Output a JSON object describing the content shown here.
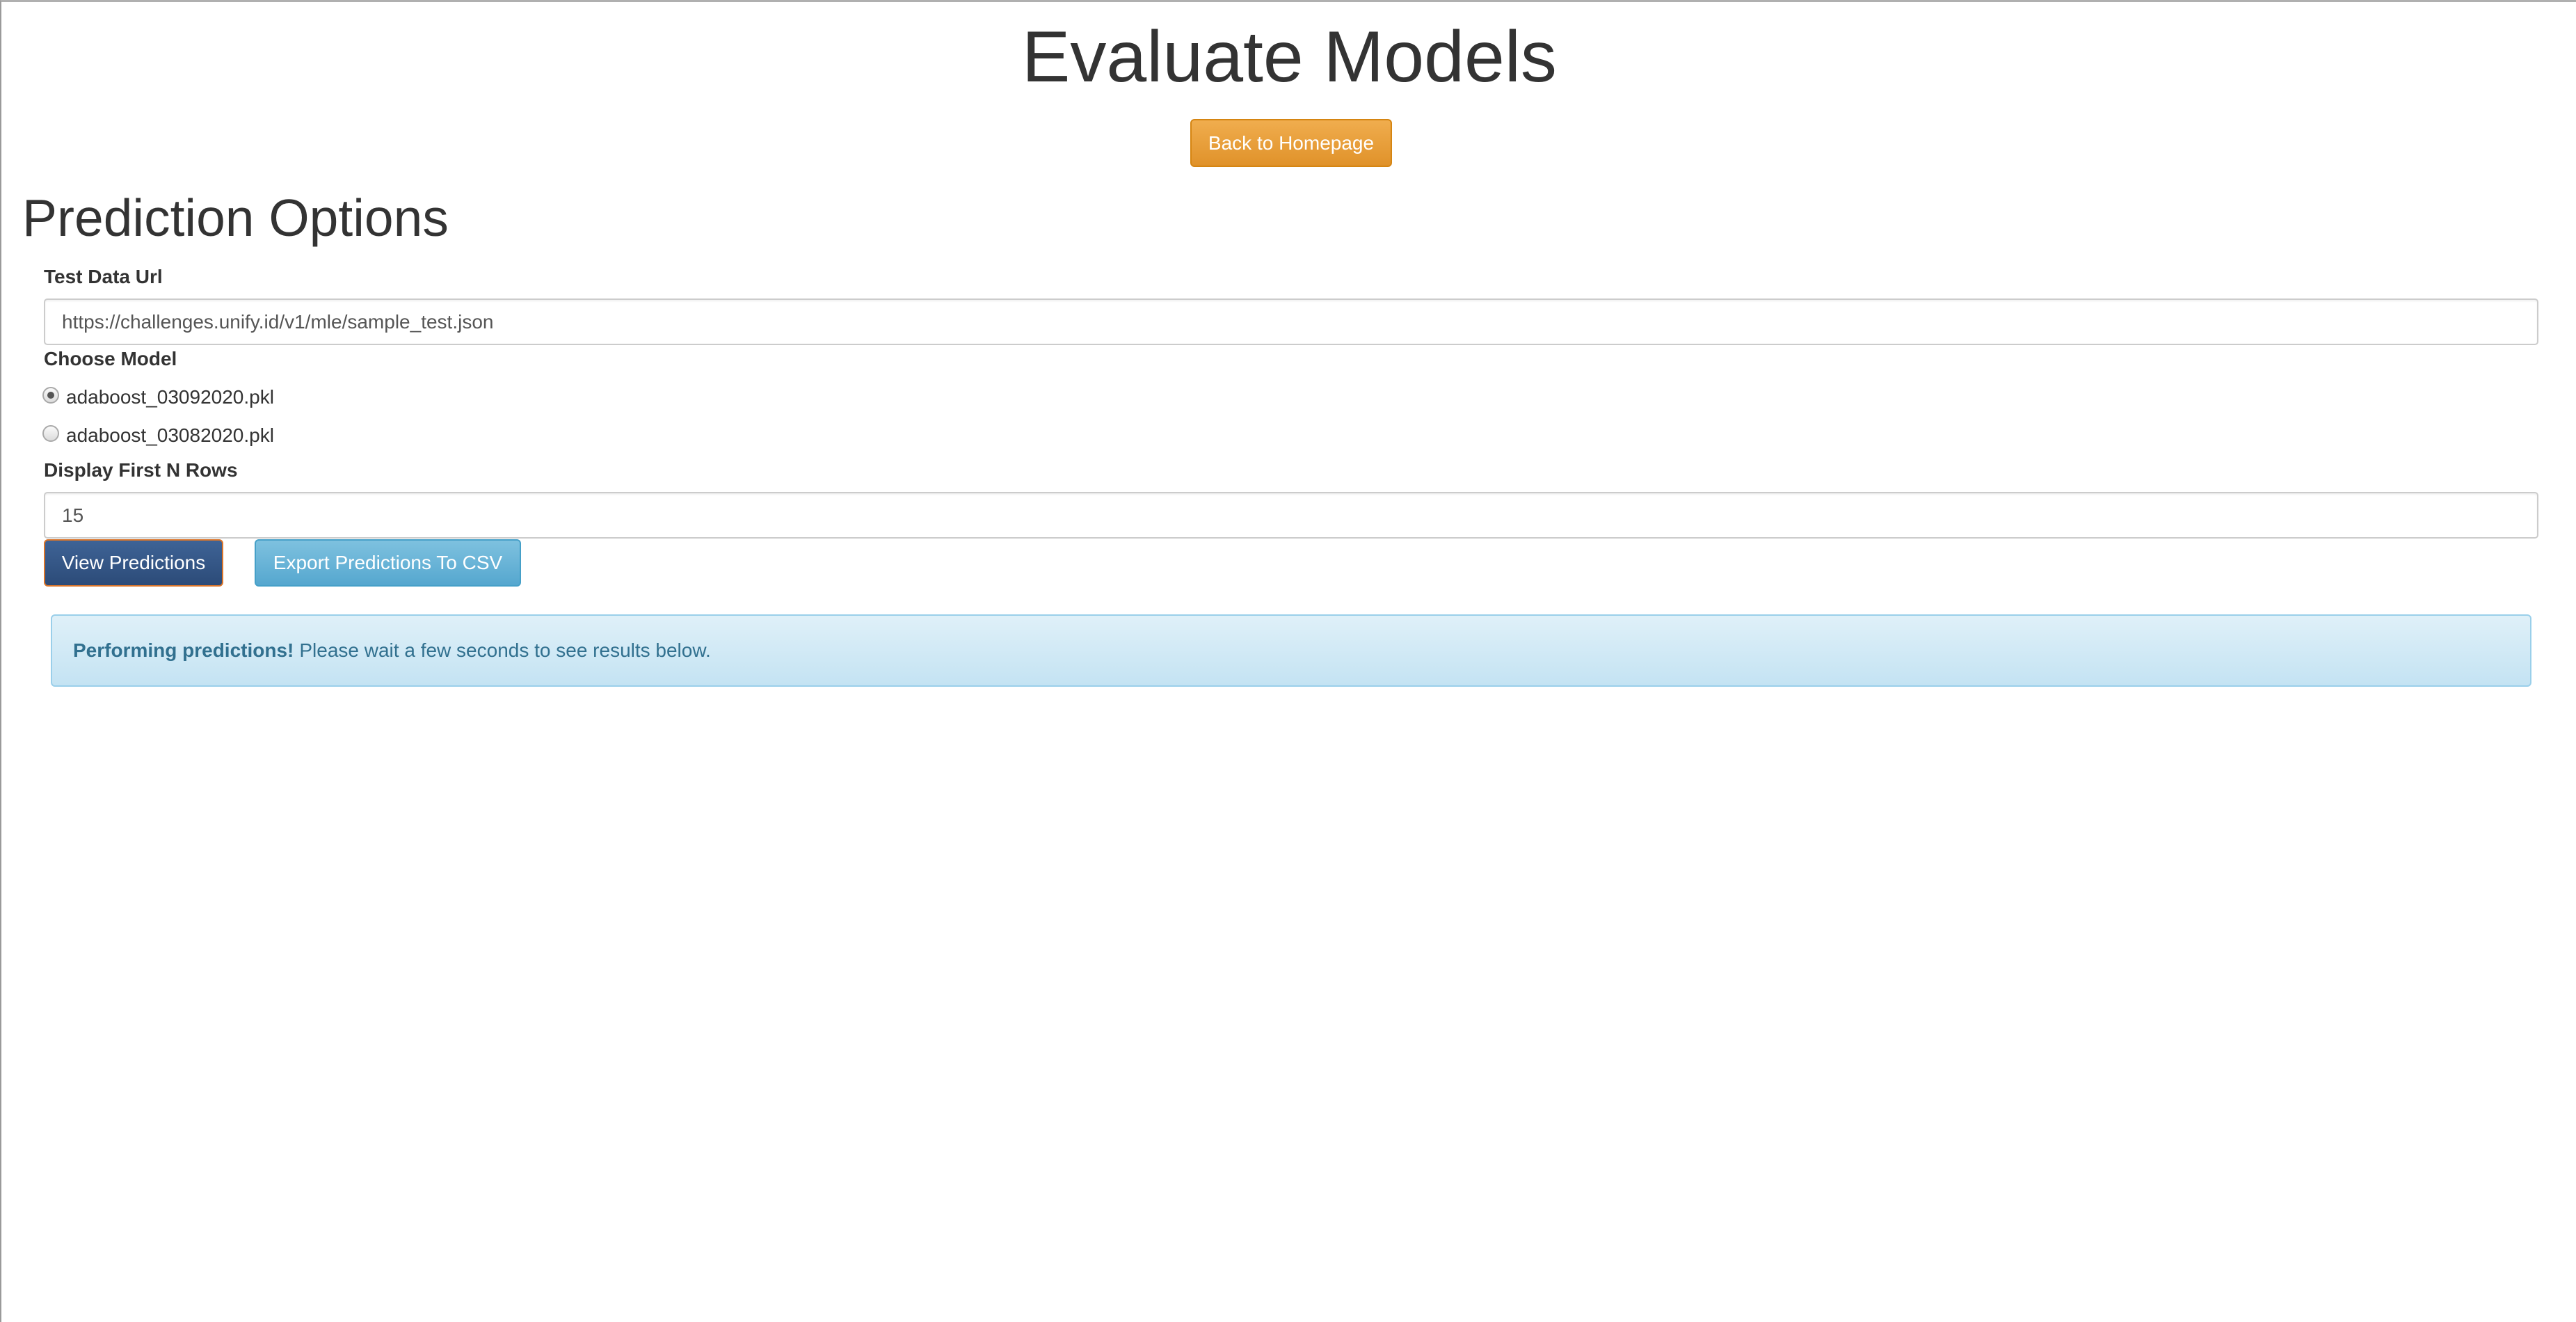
{
  "header": {
    "title": "Evaluate Models",
    "back_button_label": "Back to Homepage"
  },
  "prediction_options": {
    "title": "Prediction Options",
    "test_data_url": {
      "label": "Test Data Url",
      "value": "https://challenges.unify.id/v1/mle/sample_test.json"
    },
    "choose_model": {
      "label": "Choose Model",
      "options": [
        {
          "label": "adaboost_03092020.pkl",
          "checked": true
        },
        {
          "label": "adaboost_03082020.pkl",
          "checked": false
        }
      ]
    },
    "display_rows": {
      "label": "Display First N Rows",
      "value": "15"
    },
    "view_button_label": "View Predictions",
    "export_button_label": "Export Predictions To CSV"
  },
  "alert": {
    "strong": "Performing predictions!",
    "message": "Please wait a few seconds to see results below."
  },
  "colors": {
    "warning": "#f0ad4e",
    "primary": "#2c4b78",
    "info": "#5bc0de",
    "alert_text": "#31708f"
  }
}
